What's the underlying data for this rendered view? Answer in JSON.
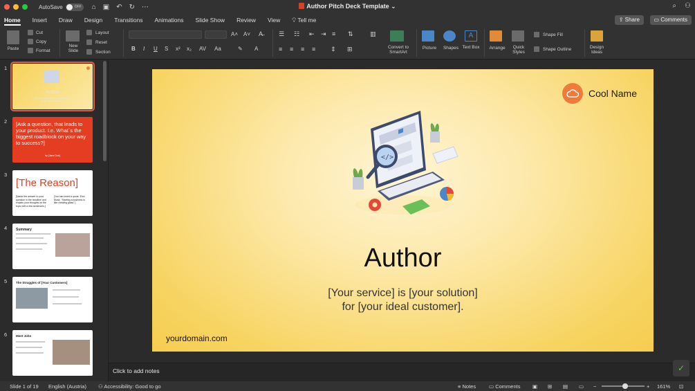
{
  "titlebar": {
    "autosave_label": "AutoSave",
    "autosave_state": "OFF",
    "doc_title": "Author Pitch Deck Template"
  },
  "tabs": [
    {
      "label": "Home",
      "active": true
    },
    {
      "label": "Insert"
    },
    {
      "label": "Draw"
    },
    {
      "label": "Design"
    },
    {
      "label": "Transitions"
    },
    {
      "label": "Animations"
    },
    {
      "label": "Slide Show"
    },
    {
      "label": "Review"
    },
    {
      "label": "View"
    },
    {
      "label": "Tell me"
    }
  ],
  "header_buttons": {
    "share": "Share",
    "comments": "Comments"
  },
  "ribbon": {
    "paste": "Paste",
    "cut": "Cut",
    "copy": "Copy",
    "format": "Format",
    "new_slide": "New Slide",
    "layout": "Layout",
    "reset": "Reset",
    "section": "Section",
    "convert_smartart": "Convert to SmartArt",
    "picture": "Picture",
    "shapes": "Shapes",
    "text_box": "Text Box",
    "arrange": "Arrange",
    "quick_styles": "Quick Styles",
    "shape_fill": "Shape Fill",
    "shape_outline": "Shape Outline",
    "design_ideas": "Design Ideas"
  },
  "thumbnails": {
    "t1": {
      "num": "1",
      "title": "Author",
      "sub": "[Your service] is [your solution] for [your ideal customer]"
    },
    "t2": {
      "num": "2",
      "text": "[Ask a question, that leads to your product. I.e. What´s the biggest roadblock on your way to success?]",
      "credit": "by [Jane Doe]"
    },
    "t3": {
      "num": "3",
      "title": "[The Reason]",
      "left": "[Name the answer to your question in the headline and explain your thoughts on the topic with a few sentences.]",
      "right": "[You can insert a quote. Elon Musk: \"Starting a business is like chewing glass\".]"
    },
    "t4": {
      "num": "4",
      "title": "Summary"
    },
    "t5": {
      "num": "5",
      "title": "The Struggles of [Your Customers]"
    },
    "t6": {
      "num": "6",
      "title": "Meet John"
    }
  },
  "slide": {
    "brand_name": "Cool Name",
    "title": "Author",
    "subtitle_line1": "[Your service] is [your solution]",
    "subtitle_line2": "for [your ideal customer].",
    "domain": "yourdomain.com"
  },
  "notes_placeholder": "Click to add notes",
  "status": {
    "slide_info": "Slide 1 of 19",
    "language": "English (Austria)",
    "accessibility": "Accessibility: Good to go",
    "notes": "Notes",
    "comments": "Comments",
    "zoom": "161%"
  },
  "colors": {
    "accent_orange": "#ef7b3a",
    "slide_yellow": "#f7d462",
    "red_slide": "#e53d22",
    "chrome_dark": "#323232"
  }
}
